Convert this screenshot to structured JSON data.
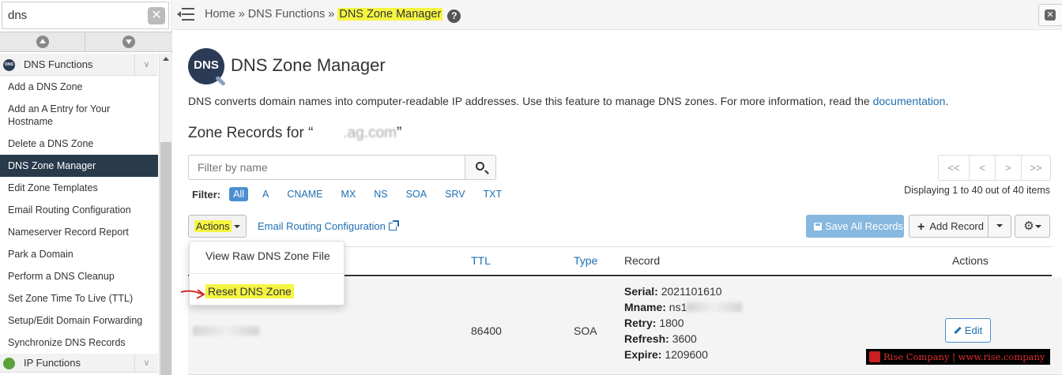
{
  "sidebar": {
    "search_value": "dns",
    "group_dns": "DNS Functions",
    "items": [
      "Add a DNS Zone",
      "Add an A Entry for Your Hostname",
      "Delete a DNS Zone",
      "DNS Zone Manager",
      "Edit Zone Templates",
      "Email Routing Configuration",
      "Nameserver Record Report",
      "Park a Domain",
      "Perform a DNS Cleanup",
      "Set Zone Time To Live (TTL)",
      "Setup/Edit Domain Forwarding",
      "Synchronize DNS Records"
    ],
    "active_item": "DNS Zone Manager",
    "group_ip": "IP Functions"
  },
  "breadcrumb": {
    "home": "Home",
    "sep": "»",
    "parent": "DNS Functions",
    "current": "DNS Zone Manager"
  },
  "header": {
    "logo_text": "DNS",
    "title": "DNS Zone Manager",
    "description": "DNS converts domain names into computer-readable IP addresses. Use this feature to manage DNS zones. For more information, read the ",
    "doc_link": "documentation",
    "desc_end": "."
  },
  "zone": {
    "title_prefix": "Zone Records for “",
    "title_suffix": "”",
    "domain_partial": "  .ag.com"
  },
  "filter": {
    "placeholder": "Filter by name",
    "label": "Filter:",
    "types": [
      "All",
      "A",
      "CNAME",
      "MX",
      "NS",
      "SOA",
      "SRV",
      "TXT"
    ],
    "active_type": "All"
  },
  "pagination": {
    "first": "<<",
    "prev": "<",
    "next": ">",
    "last": ">>",
    "displaying": "Displaying 1 to 40 out of 40 items"
  },
  "toolbar": {
    "actions": "Actions",
    "email_routing": "Email Routing Configuration",
    "save_all": "Save All Records",
    "add_record": "Add Record"
  },
  "dropdown": {
    "view_raw": "View Raw DNS Zone File",
    "reset": "Reset DNS Zone"
  },
  "table": {
    "columns": {
      "ttl": "TTL",
      "type": "Type",
      "record": "Record",
      "actions": "Actions"
    },
    "row": {
      "ttl": "86400",
      "type": "SOA",
      "record": [
        {
          "label": "Serial:",
          "value": "2021101610"
        },
        {
          "label": "Mname:",
          "value": "ns1"
        },
        {
          "label": "Retry:",
          "value": "1800"
        },
        {
          "label": "Refresh:",
          "value": "3600"
        },
        {
          "label": "Expire:",
          "value": "1209600"
        }
      ],
      "edit": "Edit"
    }
  },
  "watermark": "Rise Company | www.rise.company",
  "colors": {
    "accent": "#1f6fb2",
    "highlight": "#f5f542",
    "sidebar_active": "#293a4a",
    "save_btn": "#86b8e0"
  }
}
